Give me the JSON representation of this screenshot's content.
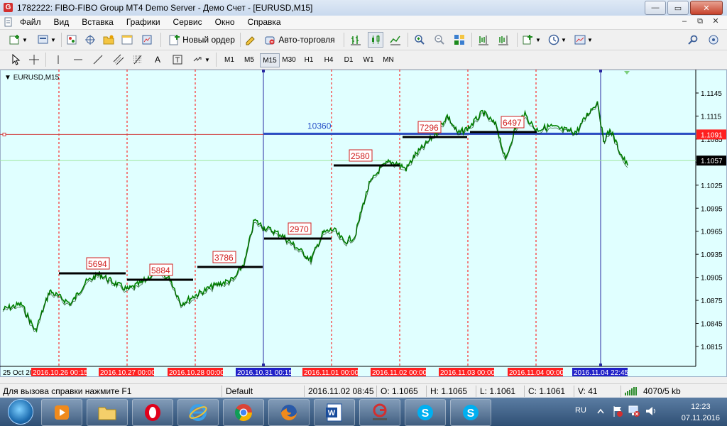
{
  "window": {
    "title": "1782222: FIBO-FIBO Group MT4 Demo Server - Демо Счет - [EURUSD,M15]",
    "app_icon": "G"
  },
  "menu": {
    "items": [
      "Файл",
      "Вид",
      "Вставка",
      "Графики",
      "Сервис",
      "Окно",
      "Справка"
    ]
  },
  "toolbar": {
    "new_order_label": "Новый ордер",
    "auto_trading_label": "Авто-торговля"
  },
  "timeframes": [
    "M1",
    "M5",
    "M15",
    "M30",
    "H1",
    "H4",
    "D1",
    "W1",
    "MN"
  ],
  "active_timeframe": "M15",
  "chart": {
    "symbol_label": "EURUSD,M15",
    "background": "#e0ffff",
    "price_axis": [
      "1.1145",
      "1.1115",
      "1.1085",
      "1.1055",
      "1.1025",
      "1.0995",
      "1.0965",
      "1.0935",
      "1.0905",
      "1.0875",
      "1.0845",
      "1.0815"
    ],
    "price_labels": {
      "red_line": "1.1091",
      "current": "1.1057"
    },
    "time_axis_plain": [
      "25 Oct 20"
    ],
    "time_axis_marked": [
      {
        "label": "2016.10.26 00:15",
        "color": "#ff2020"
      },
      {
        "label": "2016.10.27 00:00",
        "color": "#ff2020"
      },
      {
        "label": "2016.10.28 00:00",
        "color": "#ff2020"
      },
      {
        "label": "2016.10.31 00:15",
        "color": "#2020c8"
      },
      {
        "label": "2016.11.01 00:00",
        "color": "#ff2020"
      },
      {
        "label": "2016.11.02 00:00",
        "color": "#ff2020"
      },
      {
        "label": "2016.11.03 00:00",
        "color": "#ff2020"
      },
      {
        "label": "2016.11.04 00:00",
        "color": "#ff2020"
      },
      {
        "label": "2016.11.04 22:45",
        "color": "#2020c8"
      }
    ],
    "blue_level_label": "10360",
    "volume_labels": [
      "5694",
      "5884",
      "3786",
      "2970",
      "2580",
      "7296",
      "6497"
    ],
    "colors": {
      "candle": "#008000",
      "day_separator": "#ff0000",
      "week_separator": "#2828a0",
      "blue_level": "#2850c8",
      "level_segment": "#000000",
      "current_line": "#9ee59e"
    }
  },
  "status": {
    "help": "Для вызова справки нажмите F1",
    "profile": "Default",
    "datetime": "2016.11.02 08:45",
    "open": "O: 1.1065",
    "high": "H: 1.1065",
    "low": "L: 1.1061",
    "close": "C: 1.1061",
    "volume": "V: 41",
    "traffic": "4070/5 kb"
  },
  "taskbar": {
    "language": "RU",
    "time": "12:23",
    "date": "07.11.2016"
  }
}
